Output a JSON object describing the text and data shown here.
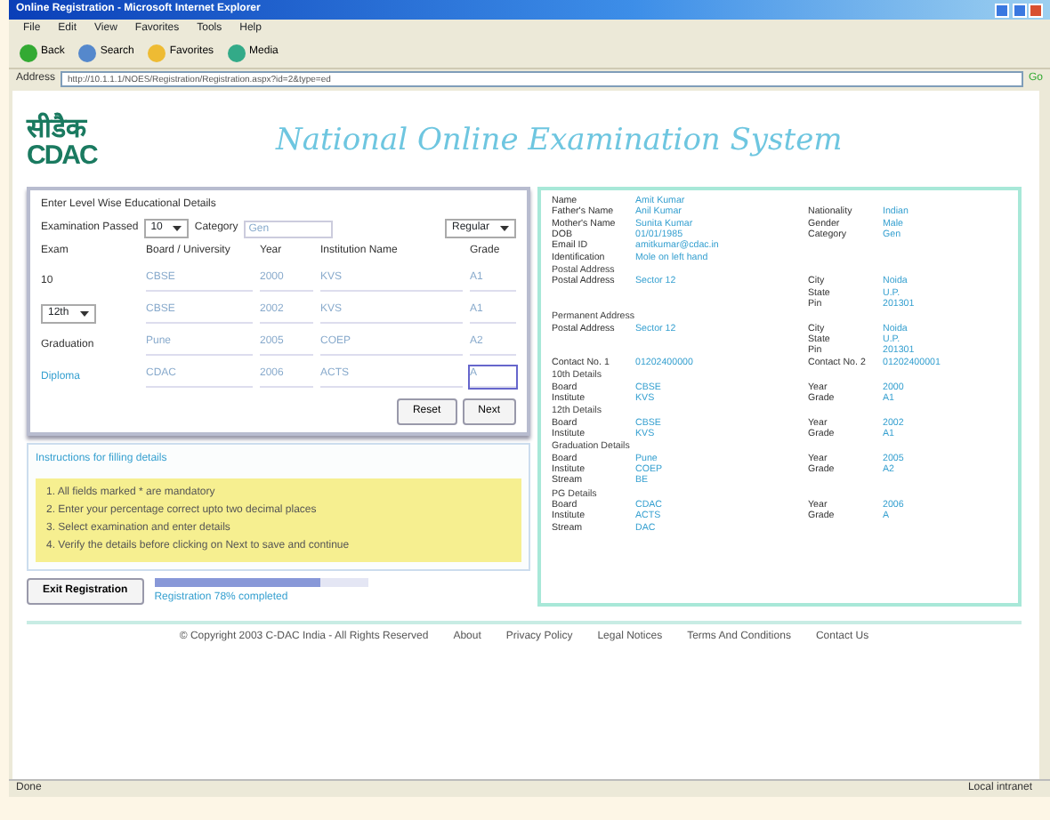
{
  "window": {
    "title": "Online Registration - Microsoft Internet Explorer"
  },
  "menu": [
    "File",
    "Edit",
    "View",
    "Favorites",
    "Tools",
    "Help"
  ],
  "toolbar": [
    "Back",
    "Search",
    "Favorites",
    "Media"
  ],
  "address": {
    "label": "Address",
    "url": "http://10.1.1.1/NOES/Registration/Registration.aspx?id=2&type=ed",
    "go": "Go"
  },
  "header": {
    "logo_hindi": "सीडैक",
    "logo_latin": "CDAC",
    "title": "National Online Examination System"
  },
  "form": {
    "title": "Enter Level Wise Educational Details",
    "filter": [
      {
        "kind": "label",
        "text": "Examination Passed"
      },
      {
        "kind": "select",
        "text": "10"
      },
      {
        "kind": "label",
        "text": "Category"
      },
      {
        "kind": "input",
        "text": "Gen"
      },
      {
        "kind": "select",
        "text": "Regular"
      }
    ],
    "columns": [
      "Exam",
      "Board / University",
      "Year",
      "Institution Name",
      "Grade"
    ],
    "rows": [
      {
        "exam": "10",
        "kind": "text",
        "board": "CBSE",
        "year": "2000",
        "institution": "KVS",
        "grade": "A1",
        "focused": false
      },
      {
        "exam": "12th",
        "kind": "select",
        "board": "CBSE",
        "year": "2002",
        "institution": "KVS",
        "grade": "A1",
        "focused": false
      },
      {
        "exam": "Graduation",
        "kind": "text",
        "board": "Pune",
        "year": "2005",
        "institution": "COEP",
        "grade": "A2",
        "focused": false
      },
      {
        "exam": "Diploma",
        "kind": "link",
        "board": "CDAC",
        "year": "2006",
        "institution": "ACTS",
        "grade": "A",
        "focused": true
      }
    ],
    "buttons": [
      "Reset",
      "Next"
    ]
  },
  "instructions": {
    "title": "Instructions for filling details",
    "lines": [
      "1. All fields marked * are mandatory",
      "2. Enter your percentage correct upto two decimal places",
      "3. Select examination and enter details",
      "4. Verify the details before clicking on Next to save and continue"
    ]
  },
  "exit_button": "Exit Registration",
  "progress": {
    "level": 0.78,
    "text": "Registration 78% completed"
  },
  "profile": {
    "fields": [
      {
        "label": "Name",
        "value": "Amit Kumar"
      },
      {
        "label": "Father's Name",
        "value": "Anil Kumar",
        "label2": "Nationality",
        "value2": "Indian"
      },
      {
        "label": "Mother's Name",
        "value": "Sunita Kumar",
        "label2": "Gender",
        "value2": "Male"
      },
      {
        "label": "DOB",
        "value": "01/01/1985",
        "label2": "Category",
        "value2": "Gen"
      },
      {
        "label": "Email ID",
        "value": "amitkumar@cdac.in"
      },
      {
        "label": "Identification",
        "value": "Mole on left hand"
      }
    ],
    "addresses": [
      {
        "title": "Postal Address",
        "label": "Postal Address",
        "value": "Sector 12",
        "lines": [
          [
            "City",
            "Noida"
          ],
          [
            "State",
            "U.P."
          ],
          [
            "Pin",
            "201301"
          ]
        ]
      },
      {
        "title": "Permanent Address",
        "label": "Postal Address",
        "value": "Sector 12",
        "lines": [
          [
            "City",
            "Noida"
          ],
          [
            "State",
            "U.P."
          ],
          [
            "Pin",
            "201301"
          ]
        ]
      }
    ],
    "contact": {
      "label": "Contact No. 1",
      "value": "01202400000",
      "label2": "Contact No. 2",
      "value2": "01202400001"
    },
    "sections": [
      {
        "title": "10th Details",
        "rows": [
          [
            "Board",
            "CBSE",
            "Year",
            "2000"
          ],
          [
            "Institute",
            "KVS",
            "Grade",
            "A1"
          ]
        ]
      },
      {
        "title": "12th Details",
        "rows": [
          [
            "Board",
            "CBSE",
            "Year",
            "2002"
          ],
          [
            "Institute",
            "KVS",
            "Grade",
            "A1"
          ]
        ]
      },
      {
        "title": "Graduation Details",
        "rows": [
          [
            "Board",
            "Pune",
            "Year",
            "2005"
          ],
          [
            "Institute",
            "COEP",
            "Grade",
            "A2"
          ],
          [
            "Stream",
            "BE",
            null,
            null
          ]
        ]
      },
      {
        "title": "PG Details",
        "rows": [
          [
            "Board",
            "CDAC",
            "Year",
            "2006"
          ],
          [
            "Institute",
            "ACTS",
            "Grade",
            "A"
          ],
          [
            "Stream",
            "DAC",
            null,
            null
          ]
        ]
      }
    ]
  },
  "footer": {
    "copyright": "© Copyright 2003 C-DAC India - All Rights Reserved",
    "links": [
      "About",
      "Privacy Policy",
      "Legal Notices",
      "Terms And Conditions",
      "Contact Us"
    ]
  },
  "status_bar": {
    "left": "Done",
    "right": "Local intranet"
  }
}
